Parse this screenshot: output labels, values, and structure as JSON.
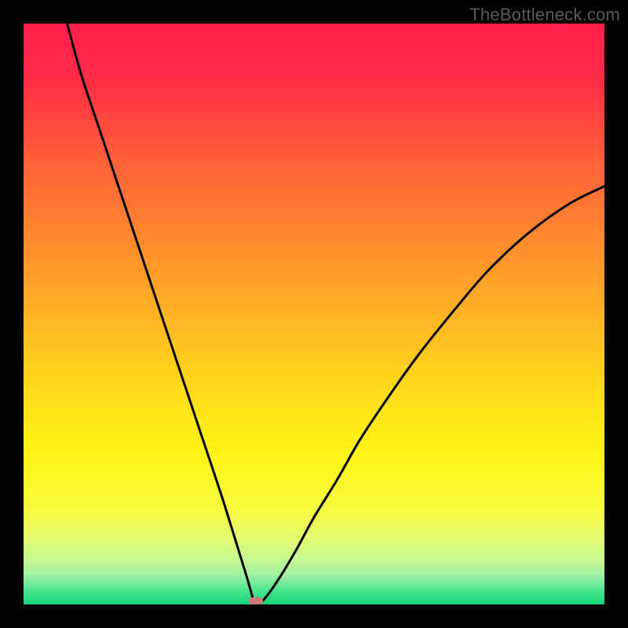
{
  "attribution": "TheBottleneck.com",
  "colors": {
    "bg_black": "#000000",
    "attrib_text": "#5b5b5b",
    "curve": "#000000",
    "gradient_stops": [
      {
        "offset": 0.0,
        "color": "#ff1f4d"
      },
      {
        "offset": 0.1,
        "color": "#ff2e46"
      },
      {
        "offset": 0.22,
        "color": "#ff5a3a"
      },
      {
        "offset": 0.35,
        "color": "#ff8330"
      },
      {
        "offset": 0.5,
        "color": "#ffb325"
      },
      {
        "offset": 0.62,
        "color": "#ffd81a"
      },
      {
        "offset": 0.74,
        "color": "#fff315"
      },
      {
        "offset": 0.83,
        "color": "#f7fb3a"
      },
      {
        "offset": 0.88,
        "color": "#e7fb6a"
      },
      {
        "offset": 0.92,
        "color": "#c9f98f"
      },
      {
        "offset": 0.95,
        "color": "#9ff2a3"
      },
      {
        "offset": 0.975,
        "color": "#4fe58f"
      },
      {
        "offset": 1.0,
        "color": "#14d67a"
      }
    ],
    "minimum_marker": "#cf7a78"
  },
  "chart_data": {
    "type": "line",
    "title": "",
    "xlabel": "",
    "ylabel": "",
    "xlim": [
      0,
      1
    ],
    "ylim": [
      0,
      1
    ],
    "minimum_x": 0.4,
    "curve_left": {
      "x0": 0.075,
      "y0": 1.0,
      "x1": 0.395,
      "y1": 0.0,
      "shape": "concave-down-toward-min"
    },
    "curve_right": {
      "x0": 0.415,
      "y0": 0.0,
      "x1": 1.0,
      "y1": 0.72,
      "shape": "concave-up-away-from-min"
    },
    "series": [
      {
        "name": "bottleneck-curve",
        "x": [
          0.075,
          0.1,
          0.13,
          0.16,
          0.19,
          0.22,
          0.25,
          0.28,
          0.31,
          0.34,
          0.365,
          0.385,
          0.395,
          0.4,
          0.415,
          0.44,
          0.47,
          0.5,
          0.54,
          0.58,
          0.63,
          0.68,
          0.74,
          0.8,
          0.87,
          0.94,
          1.0
        ],
        "y": [
          1.0,
          0.91,
          0.82,
          0.73,
          0.64,
          0.55,
          0.46,
          0.37,
          0.28,
          0.19,
          0.11,
          0.045,
          0.01,
          0.0,
          0.01,
          0.045,
          0.095,
          0.15,
          0.215,
          0.285,
          0.36,
          0.43,
          0.505,
          0.575,
          0.64,
          0.69,
          0.72
        ]
      }
    ],
    "annotations": []
  }
}
